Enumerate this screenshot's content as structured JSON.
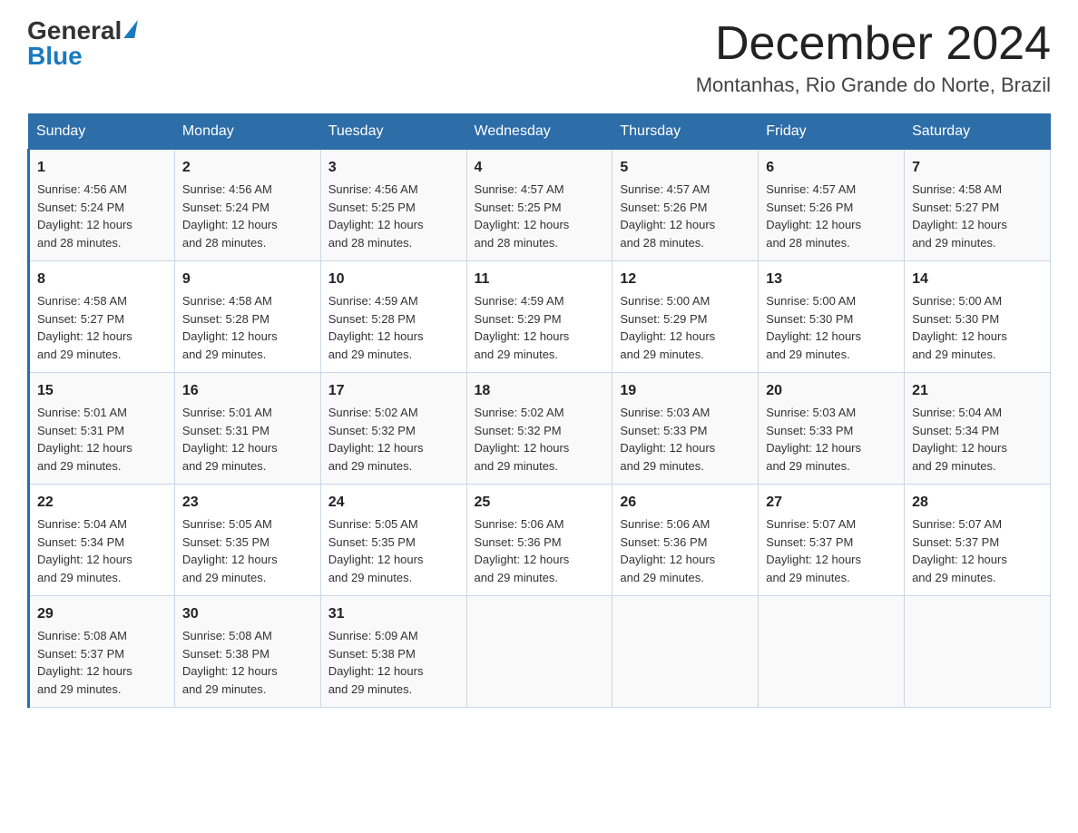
{
  "header": {
    "logo_general": "General",
    "logo_blue": "Blue",
    "month_title": "December 2024",
    "location": "Montanhas, Rio Grande do Norte, Brazil"
  },
  "weekdays": [
    "Sunday",
    "Monday",
    "Tuesday",
    "Wednesday",
    "Thursday",
    "Friday",
    "Saturday"
  ],
  "weeks": [
    [
      {
        "day": "1",
        "sunrise": "4:56 AM",
        "sunset": "5:24 PM",
        "daylight": "12 hours and 28 minutes."
      },
      {
        "day": "2",
        "sunrise": "4:56 AM",
        "sunset": "5:24 PM",
        "daylight": "12 hours and 28 minutes."
      },
      {
        "day": "3",
        "sunrise": "4:56 AM",
        "sunset": "5:25 PM",
        "daylight": "12 hours and 28 minutes."
      },
      {
        "day": "4",
        "sunrise": "4:57 AM",
        "sunset": "5:25 PM",
        "daylight": "12 hours and 28 minutes."
      },
      {
        "day": "5",
        "sunrise": "4:57 AM",
        "sunset": "5:26 PM",
        "daylight": "12 hours and 28 minutes."
      },
      {
        "day": "6",
        "sunrise": "4:57 AM",
        "sunset": "5:26 PM",
        "daylight": "12 hours and 28 minutes."
      },
      {
        "day": "7",
        "sunrise": "4:58 AM",
        "sunset": "5:27 PM",
        "daylight": "12 hours and 29 minutes."
      }
    ],
    [
      {
        "day": "8",
        "sunrise": "4:58 AM",
        "sunset": "5:27 PM",
        "daylight": "12 hours and 29 minutes."
      },
      {
        "day": "9",
        "sunrise": "4:58 AM",
        "sunset": "5:28 PM",
        "daylight": "12 hours and 29 minutes."
      },
      {
        "day": "10",
        "sunrise": "4:59 AM",
        "sunset": "5:28 PM",
        "daylight": "12 hours and 29 minutes."
      },
      {
        "day": "11",
        "sunrise": "4:59 AM",
        "sunset": "5:29 PM",
        "daylight": "12 hours and 29 minutes."
      },
      {
        "day": "12",
        "sunrise": "5:00 AM",
        "sunset": "5:29 PM",
        "daylight": "12 hours and 29 minutes."
      },
      {
        "day": "13",
        "sunrise": "5:00 AM",
        "sunset": "5:30 PM",
        "daylight": "12 hours and 29 minutes."
      },
      {
        "day": "14",
        "sunrise": "5:00 AM",
        "sunset": "5:30 PM",
        "daylight": "12 hours and 29 minutes."
      }
    ],
    [
      {
        "day": "15",
        "sunrise": "5:01 AM",
        "sunset": "5:31 PM",
        "daylight": "12 hours and 29 minutes."
      },
      {
        "day": "16",
        "sunrise": "5:01 AM",
        "sunset": "5:31 PM",
        "daylight": "12 hours and 29 minutes."
      },
      {
        "day": "17",
        "sunrise": "5:02 AM",
        "sunset": "5:32 PM",
        "daylight": "12 hours and 29 minutes."
      },
      {
        "day": "18",
        "sunrise": "5:02 AM",
        "sunset": "5:32 PM",
        "daylight": "12 hours and 29 minutes."
      },
      {
        "day": "19",
        "sunrise": "5:03 AM",
        "sunset": "5:33 PM",
        "daylight": "12 hours and 29 minutes."
      },
      {
        "day": "20",
        "sunrise": "5:03 AM",
        "sunset": "5:33 PM",
        "daylight": "12 hours and 29 minutes."
      },
      {
        "day": "21",
        "sunrise": "5:04 AM",
        "sunset": "5:34 PM",
        "daylight": "12 hours and 29 minutes."
      }
    ],
    [
      {
        "day": "22",
        "sunrise": "5:04 AM",
        "sunset": "5:34 PM",
        "daylight": "12 hours and 29 minutes."
      },
      {
        "day": "23",
        "sunrise": "5:05 AM",
        "sunset": "5:35 PM",
        "daylight": "12 hours and 29 minutes."
      },
      {
        "day": "24",
        "sunrise": "5:05 AM",
        "sunset": "5:35 PM",
        "daylight": "12 hours and 29 minutes."
      },
      {
        "day": "25",
        "sunrise": "5:06 AM",
        "sunset": "5:36 PM",
        "daylight": "12 hours and 29 minutes."
      },
      {
        "day": "26",
        "sunrise": "5:06 AM",
        "sunset": "5:36 PM",
        "daylight": "12 hours and 29 minutes."
      },
      {
        "day": "27",
        "sunrise": "5:07 AM",
        "sunset": "5:37 PM",
        "daylight": "12 hours and 29 minutes."
      },
      {
        "day": "28",
        "sunrise": "5:07 AM",
        "sunset": "5:37 PM",
        "daylight": "12 hours and 29 minutes."
      }
    ],
    [
      {
        "day": "29",
        "sunrise": "5:08 AM",
        "sunset": "5:37 PM",
        "daylight": "12 hours and 29 minutes."
      },
      {
        "day": "30",
        "sunrise": "5:08 AM",
        "sunset": "5:38 PM",
        "daylight": "12 hours and 29 minutes."
      },
      {
        "day": "31",
        "sunrise": "5:09 AM",
        "sunset": "5:38 PM",
        "daylight": "12 hours and 29 minutes."
      },
      {
        "day": "",
        "sunrise": "",
        "sunset": "",
        "daylight": ""
      },
      {
        "day": "",
        "sunrise": "",
        "sunset": "",
        "daylight": ""
      },
      {
        "day": "",
        "sunrise": "",
        "sunset": "",
        "daylight": ""
      },
      {
        "day": "",
        "sunrise": "",
        "sunset": "",
        "daylight": ""
      }
    ]
  ],
  "labels": {
    "sunrise": "Sunrise: ",
    "sunset": "Sunset: ",
    "daylight": "Daylight: "
  }
}
